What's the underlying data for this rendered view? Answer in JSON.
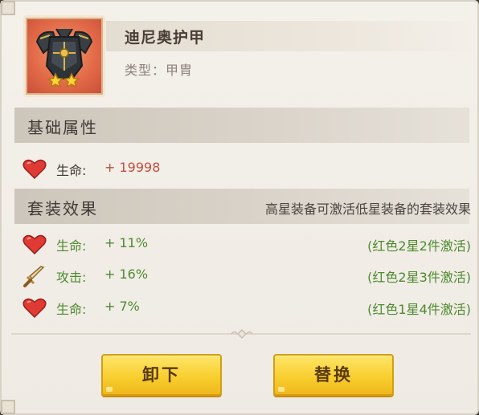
{
  "item": {
    "name": "迪尼奥护甲",
    "type_label": "类型：",
    "type_value": "甲胄",
    "stars": 2,
    "icon": "armor-icon"
  },
  "base_section": {
    "title": "基础属性",
    "stats": [
      {
        "icon": "heart-icon",
        "label": "生命:",
        "value": "+ 19998"
      }
    ]
  },
  "set_section": {
    "title": "套装效果",
    "note": "高星装备可激活低星装备的套装效果",
    "effects": [
      {
        "icon": "heart-icon",
        "label": "生命:",
        "value": "+ 11%",
        "condition": "(红色2星2件激活)"
      },
      {
        "icon": "sword-icon",
        "label": "攻击:",
        "value": "+ 16%",
        "condition": "(红色2星3件激活)"
      },
      {
        "icon": "heart-icon",
        "label": "生命:",
        "value": "+ 7%",
        "condition": "(红色1星4件激活)"
      }
    ]
  },
  "buttons": {
    "unequip": "卸下",
    "replace": "替换"
  },
  "colors": {
    "base_value": "#c0503e",
    "set_label": "#4e8a2e",
    "button": "#f8cf30"
  }
}
